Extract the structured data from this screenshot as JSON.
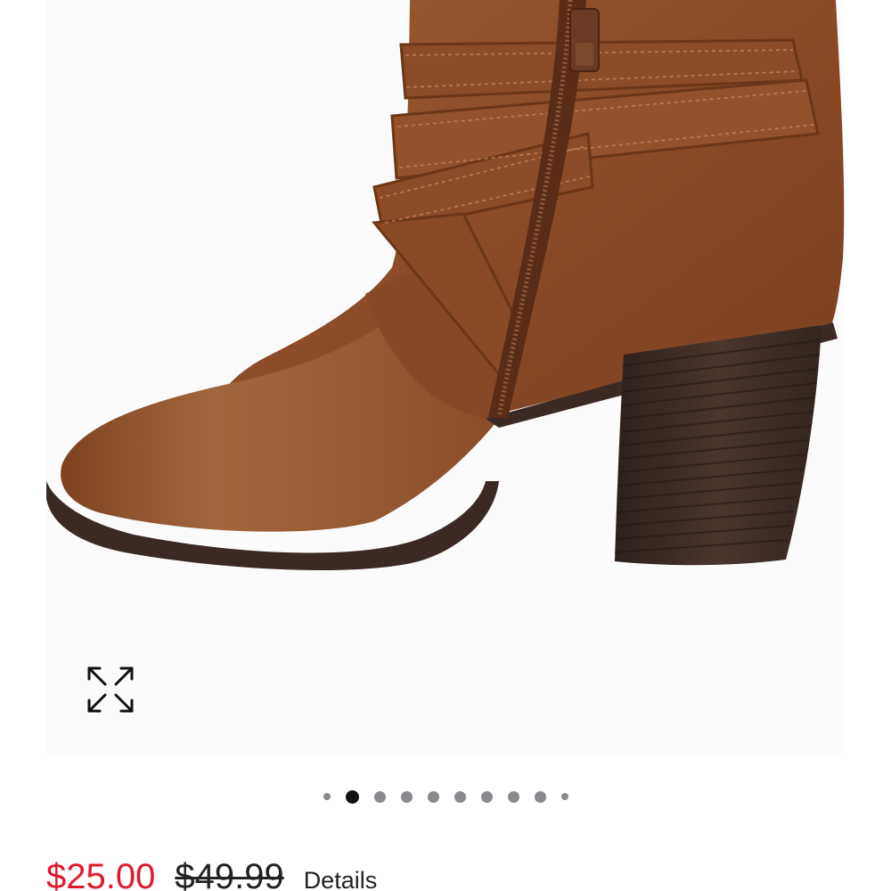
{
  "gallery": {
    "image_alt": "Brown faux-leather ankle bootie with crisscross buckle straps, side zipper and stacked block heel",
    "expand_icon": "expand-arrows-icon",
    "dots": {
      "count": 10,
      "active_index": 1
    }
  },
  "pricing": {
    "sale_price": "$25.00",
    "original_price": "$49.99",
    "details_label": "Details"
  },
  "colors": {
    "sale": "#e01a2b",
    "dot_active": "#111111",
    "dot_inactive": "#8a8a8e",
    "boot_leather": "#8b4a26",
    "heel": "#3a2a24"
  }
}
